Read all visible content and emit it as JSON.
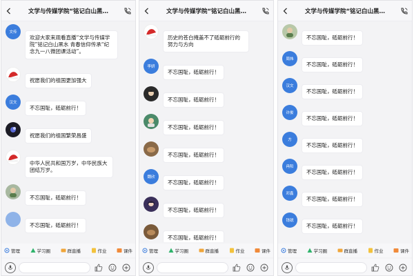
{
  "colors": {
    "brand_blue": "#3b7ddd",
    "bubble_bg": "#ffffff",
    "panel_bg": "#f3f3f5",
    "tag_orange": "#c18a2a"
  },
  "panels": [
    {
      "title": "文学与传媒学院“铭记白山黑…",
      "messages": [
        {
          "sender": "",
          "tag": "",
          "avatar": "文传",
          "avatar_style": "blue",
          "text": "欢迎大家来观看直播“文学与传媒学院”铭记白山黑水 青春信仰传承“纪念九一八微团课活动”。"
        },
        {
          "sender": "",
          "tag": "",
          "avatar": "",
          "avatar_style": "hat",
          "text": "祝愿我们的祖国更加强大"
        },
        {
          "sender": "",
          "tag": "",
          "avatar": "汉文",
          "avatar_style": "blue",
          "text": "不忘国耻，砥砺前行！"
        },
        {
          "sender": "",
          "tag": "",
          "avatar": "",
          "avatar_style": "photo",
          "text": "祝愿我们的祖国繁荣昌盛"
        },
        {
          "sender": "",
          "tag": "",
          "avatar": "",
          "avatar_style": "hat",
          "text": "中华人民共和国万岁，中华民族大团结万岁。"
        },
        {
          "sender": "",
          "tag": "",
          "avatar": "",
          "avatar_style": "photo",
          "text": "不忘国耻，砥砺前行！"
        },
        {
          "sender": "",
          "tag": "",
          "avatar": "",
          "avatar_style": "blue",
          "text": "不忘国耻，砥砺前行！"
        }
      ]
    },
    {
      "title": "文学与传媒学院“铭记白山黑…",
      "messages": [
        {
          "sender": "",
          "tag": "",
          "avatar": "",
          "avatar_style": "hat",
          "text": "历史的苍白掩盖不了砥砺前行的努力与方向"
        },
        {
          "sender": "",
          "tag": "",
          "avatar": "李妍",
          "avatar_style": "blue",
          "text": "不忘国耻，砥砺前行！"
        },
        {
          "sender": "",
          "tag": "",
          "avatar": "",
          "avatar_style": "photo",
          "text": "不忘国耻，砥砺前行！"
        },
        {
          "sender": "",
          "tag": "",
          "avatar": "",
          "avatar_style": "photo",
          "text": "不忘国耻，砥砺前行！"
        },
        {
          "sender": "",
          "tag": "",
          "avatar": "",
          "avatar_style": "photo",
          "text": "不忘国耻，砥砺前行！"
        },
        {
          "sender": "",
          "tag": "",
          "avatar": "魏欣",
          "avatar_style": "blue",
          "text": "不忘国耻，砥砺前行！"
        },
        {
          "sender": "",
          "tag": "",
          "avatar": "",
          "avatar_style": "photo",
          "text": "不忘国耻，砥砺前行！"
        },
        {
          "sender": "",
          "tag": "",
          "avatar": "",
          "avatar_style": "photo",
          "text": "不忘国耻，砥砺前行！"
        }
      ]
    },
    {
      "title": "文学与传媒学院“铭记白山黑…",
      "messages": [
        {
          "sender": "",
          "tag": "",
          "avatar": "",
          "avatar_style": "photo",
          "text": "不忘国耻，砥砺前行！"
        },
        {
          "sender": "",
          "tag": "",
          "avatar": "周炜",
          "avatar_style": "blue",
          "text": "不忘国耻，砥砺前行！"
        },
        {
          "sender": "",
          "tag": "",
          "avatar": "汉文",
          "avatar_style": "blue",
          "text": "不忘国耻，砥砺前行！"
        },
        {
          "sender": "",
          "tag": "",
          "avatar": "许俊",
          "avatar_style": "blue",
          "text": "不忘国耻，砥砺前行！"
        },
        {
          "sender": "",
          "tag": "",
          "avatar": "方",
          "avatar_style": "blue",
          "text": "不忘国耻，砥砺前行！"
        },
        {
          "sender": "",
          "tag": "",
          "avatar": "冉阳",
          "avatar_style": "blue",
          "text": "不忘国耻，砥砺前行！"
        },
        {
          "sender": "",
          "tag": "",
          "avatar": "邓鑫",
          "avatar_style": "blue",
          "text": "不忘国耻，砥砺前行！"
        },
        {
          "sender": "",
          "tag": "",
          "avatar": "钱锐",
          "avatar_style": "blue",
          "text": "不忘国耻，砥砺前行！"
        }
      ]
    }
  ],
  "toolbar": {
    "items": [
      {
        "label": "管理",
        "icon": "manage-icon"
      },
      {
        "label": "学习圈",
        "icon": "study-circle-icon"
      },
      {
        "label": "群直播",
        "icon": "group-live-icon"
      },
      {
        "label": "作业",
        "icon": "homework-icon"
      },
      {
        "label": "课件",
        "icon": "courseware-icon"
      }
    ]
  },
  "input": {
    "placeholder": ""
  }
}
